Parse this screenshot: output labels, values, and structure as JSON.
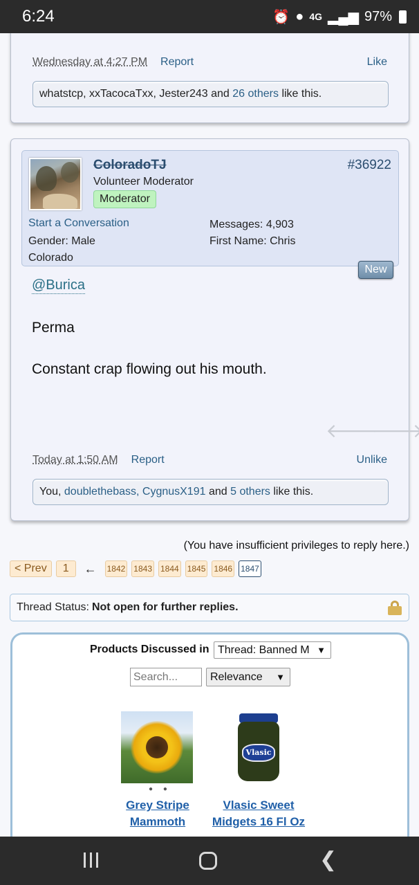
{
  "status_bar": {
    "time": "6:24",
    "network": "4G",
    "battery": "97%"
  },
  "prev_post": {
    "date": "Wednesday at 4:27 PM",
    "report": "Report",
    "like": "Like",
    "likes": {
      "users": "whatstcp, xxTacocaTxx, Jester243",
      "and": "and",
      "others": "26 others",
      "suffix": "like this."
    }
  },
  "post": {
    "username": "ColoradoTJ",
    "title": "Volunteer Moderator",
    "badge": "Moderator",
    "number": "#36922",
    "start_conversation": "Start a Conversation",
    "gender": "Gender:  Male",
    "location": "Colorado",
    "messages": "Messages:  4,903",
    "first_name": "First Name:  Chris",
    "new_label": "New",
    "mention": "@Burica",
    "line1": "Perma",
    "line2": "Constant crap flowing out his mouth.",
    "date": "Today at 1:50 AM",
    "report": "Report",
    "unlike": "Unlike",
    "likes": {
      "you": "You,",
      "users": "doublethebass, CygnusX191",
      "and": "and",
      "others": "5 others",
      "suffix": "like this."
    }
  },
  "insufficient": "(You have insufficient privileges to reply here.)",
  "pagination": {
    "prev": "< Prev",
    "first": "1",
    "arrow": "←",
    "pages": [
      "1842",
      "1843",
      "1844",
      "1845",
      "1846"
    ],
    "current": "1847"
  },
  "thread_status": {
    "label": "Thread Status:",
    "value": "Not open for further replies."
  },
  "products": {
    "label": "Products Discussed in",
    "filter": "Thread: Banned M",
    "search_placeholder": "Search...",
    "sort": "Relevance",
    "items": [
      {
        "title_line1": "Grey Stripe",
        "title_line2": "Mammoth"
      },
      {
        "title_line1": "Vlasic Sweet",
        "title_line2": "Midgets 16 Fl Oz",
        "jar_label": "Vlasic"
      }
    ]
  }
}
